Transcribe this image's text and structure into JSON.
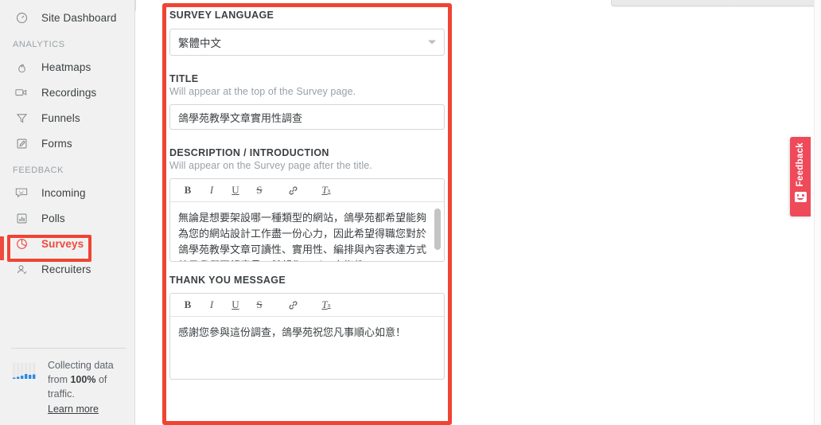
{
  "sidebar": {
    "top_item": {
      "label": "Site Dashboard",
      "icon": "gauge-icon"
    },
    "sections": [
      {
        "heading": "ANALYTICS",
        "items": [
          {
            "label": "Heatmaps",
            "icon": "flame-icon",
            "active": false
          },
          {
            "label": "Recordings",
            "icon": "video-camera-icon",
            "active": false
          },
          {
            "label": "Funnels",
            "icon": "funnel-icon",
            "active": false
          },
          {
            "label": "Forms",
            "icon": "pencil-square-icon",
            "active": false
          }
        ]
      },
      {
        "heading": "FEEDBACK",
        "items": [
          {
            "label": "Incoming",
            "icon": "smiley-box-icon",
            "active": false
          },
          {
            "label": "Polls",
            "icon": "bar-chart-icon",
            "active": false
          },
          {
            "label": "Surveys",
            "icon": "pie-chart-icon",
            "active": true
          },
          {
            "label": "Recruiters",
            "icon": "person-check-icon",
            "active": false
          }
        ]
      }
    ],
    "collecting": {
      "line1": "Collecting data",
      "from": "from ",
      "percent": "100%",
      "of": " of",
      "line3": "traffic.",
      "learn_more": "Learn more",
      "icon": "sparkline-icon"
    },
    "collapse_icon": "chevron-left-icon"
  },
  "form": {
    "language": {
      "label": "SURVEY LANGUAGE",
      "value": "繁體中文",
      "caret_icon": "chevron-down-icon"
    },
    "title": {
      "label": "TITLE",
      "help": "Will appear at the top of the Survey page.",
      "value": "鴿學苑教學文章實用性調查"
    },
    "description": {
      "label": "DESCRIPTION / INTRODUCTION",
      "help": "Will appear on the Survey page after the title.",
      "value": "無論是想要架設哪一種類型的網站，鴿學苑都希望能夠為您的網站設計工作盡一份心力，因此希望得職您對於鴿學苑教學文章可讀性、實用性、編排與內容表達方式給予我們回饋意見，希望您可以不吝指教。"
    },
    "thank_you": {
      "label": "THANK YOU MESSAGE",
      "value": "感謝您參與這份調查，鴿學苑祝您凡事順心如意！"
    },
    "toolbar": {
      "bold": "B",
      "italic": "I",
      "underline": "U",
      "strikethrough": "S",
      "link": "🔗",
      "remove_format": "T"
    }
  },
  "feedback_tab": {
    "label": "Feedback",
    "icon": "smiley-icon"
  },
  "colors": {
    "accent_red": "#ef4433",
    "highlight_red": "#ef4a3c",
    "feedback_pink": "#ef4a5a",
    "sidebar_bg": "#f1f1f1",
    "text": "#3c4043",
    "muted": "#9aa0a6"
  }
}
